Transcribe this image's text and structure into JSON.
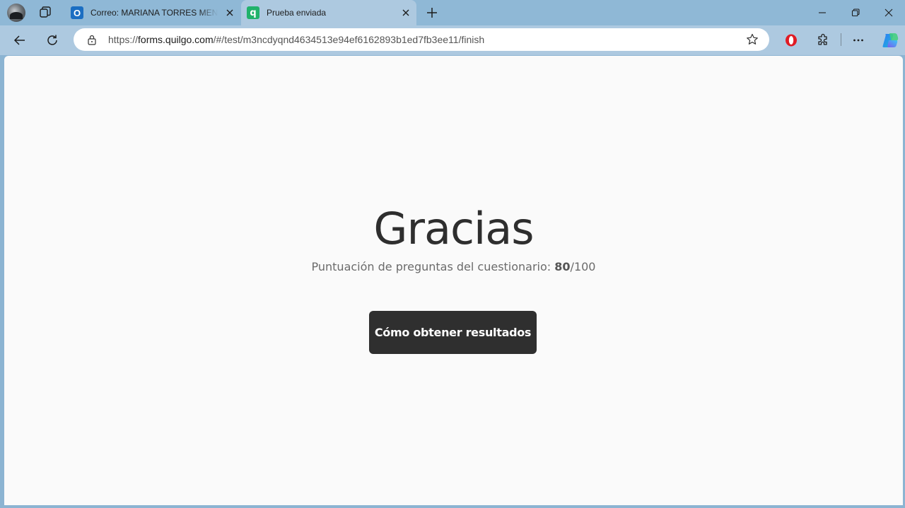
{
  "browser": {
    "tabs": [
      {
        "title": "Correo: MARIANA TORRES MENDOZA - Outlook",
        "favicon": "outlook-icon",
        "active": false
      },
      {
        "title": "Prueba enviada",
        "favicon": "quilgo-q-icon",
        "active": true
      }
    ],
    "address": {
      "prefix": "https://",
      "domain": "forms.quilgo.com",
      "path": "/#/test/m3ncdyqnd4634513e94ef6162893b1ed7fb3ee11/finish"
    }
  },
  "page": {
    "title": "Gracias",
    "score": {
      "label": "Puntuación de preguntas del cuestionario:",
      "value": "80",
      "total": "/100"
    },
    "button_label": "Cómo obtener resultados"
  },
  "colors": {
    "frame": "#8fb8d6",
    "toolbar": "#adc9e0",
    "page_bg": "#fafafa",
    "button_bg": "#2f2f2f",
    "quilgo_green": "#20b26b"
  }
}
